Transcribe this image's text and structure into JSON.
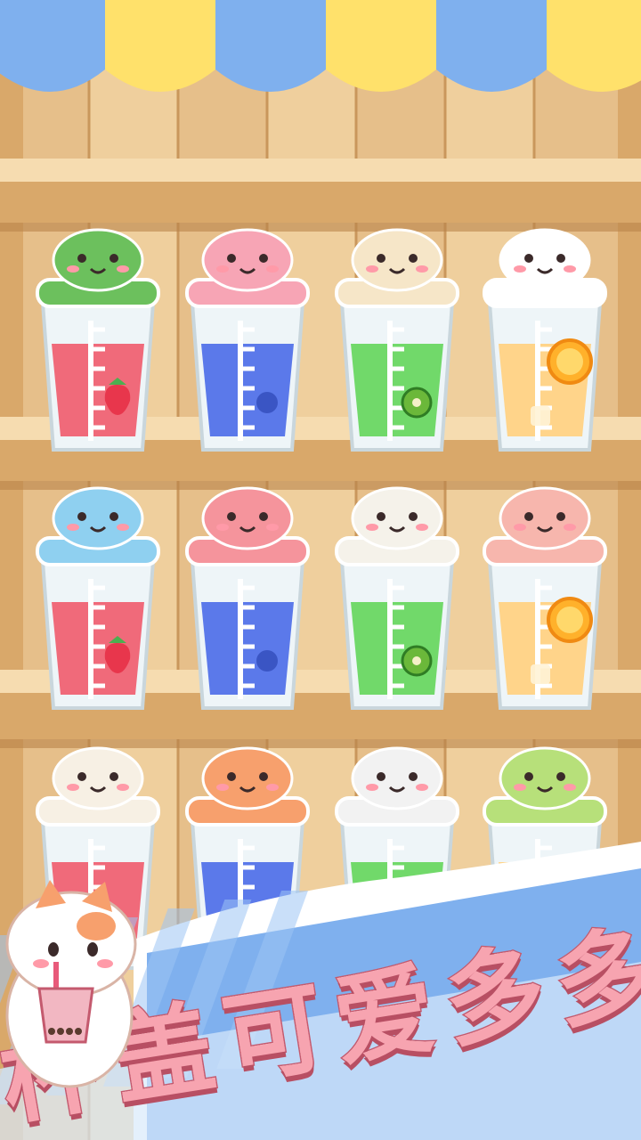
{
  "scene": {
    "awning_colors": [
      "#7fb0ee",
      "#ffe16b"
    ],
    "wood_colors": {
      "wall": "#e8c28f",
      "plank_line": "#c9975c",
      "shelf_top": "#f6dcb0",
      "shelf_front": "#d9a86a"
    }
  },
  "cups": [
    {
      "lid": "frog-lid",
      "lid_color": "#6cc05d",
      "drink_color": "#f06a7a",
      "fruit": "strawberry-icon"
    },
    {
      "lid": "bunny-lid",
      "lid_color": "#f7a5b5",
      "drink_color": "#5b79ea",
      "fruit": "blueberry-icon"
    },
    {
      "lid": "dragon-lid",
      "lid_color": "#f6e6c8",
      "drink_color": "#71d96a",
      "fruit": "kiwi-icon"
    },
    {
      "lid": "panda-lid",
      "lid_color": "#ffffff",
      "drink_color": "#ffd48a",
      "fruit": "orange-slice-icon"
    },
    {
      "lid": "octopus-lid",
      "lid_color": "#8fd0f0",
      "drink_color": "#f06a7a",
      "fruit": "strawberry-icon"
    },
    {
      "lid": "shark-lid",
      "lid_color": "#f5949c",
      "drink_color": "#5b79ea",
      "fruit": "blueberry-icon"
    },
    {
      "lid": "crab-lid",
      "lid_color": "#f5f2ea",
      "drink_color": "#71d96a",
      "fruit": "kiwi-icon"
    },
    {
      "lid": "coral-lid",
      "lid_color": "#f7b6ad",
      "drink_color": "#ffd48a",
      "fruit": "orange-slice-icon"
    },
    {
      "lid": "shiba-lid",
      "lid_color": "#f7f0e4",
      "drink_color": "#f06a7a",
      "fruit": ""
    },
    {
      "lid": "cat-lid",
      "lid_color": "#f7a06d",
      "drink_color": "#5b79ea",
      "fruit": ""
    },
    {
      "lid": "koala-lid",
      "lid_color": "#f2f2f2",
      "drink_color": "#71d96a",
      "fruit": ""
    },
    {
      "lid": "puppy-lid",
      "lid_color": "#b7e07a",
      "drink_color": "#ffd48a",
      "fruit": ""
    }
  ],
  "banner": {
    "slogan_chars": [
      "杯",
      "盖",
      "可",
      "爱",
      "多",
      "多"
    ],
    "text_color": "#f7a4b0",
    "outline_color": "#c45a6e",
    "ribbon_color": "#7fb0ee"
  },
  "mascot": {
    "name": "cat-with-bubble-tea",
    "color": "#f7a06d"
  }
}
